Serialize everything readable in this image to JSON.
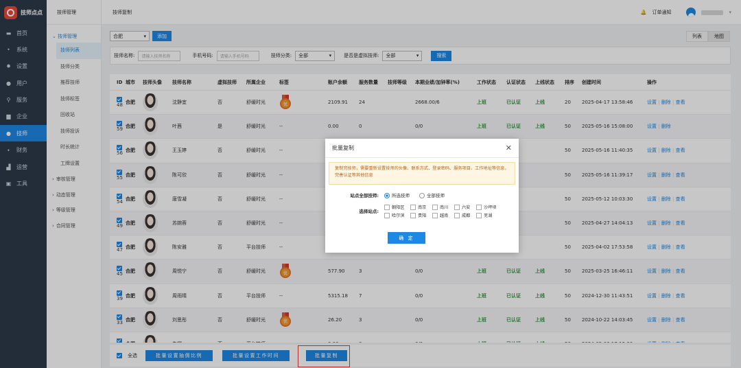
{
  "app": {
    "name": "技师点点"
  },
  "sidebar": {
    "items": [
      {
        "label": "首页",
        "icon": "monitor-icon",
        "glyph": "▬"
      },
      {
        "label": "系统",
        "icon": "sitemap-icon",
        "glyph": "⬩"
      },
      {
        "label": "设置",
        "icon": "gear-icon",
        "glyph": "✹"
      },
      {
        "label": "用户",
        "icon": "user-icon",
        "glyph": "●"
      },
      {
        "label": "服务",
        "icon": "link-icon",
        "glyph": "⚲"
      },
      {
        "label": "企业",
        "icon": "building-icon",
        "glyph": "▆"
      },
      {
        "label": "技师",
        "icon": "user-icon",
        "glyph": "●"
      },
      {
        "label": "财务",
        "icon": "sitemap-icon",
        "glyph": "⬩"
      },
      {
        "label": "运营",
        "icon": "chart-icon",
        "glyph": "▟"
      },
      {
        "label": "工具",
        "icon": "briefcase-icon",
        "glyph": "▣"
      }
    ],
    "active_index": 6
  },
  "subnav": {
    "title": "技师管理",
    "group": "技师管理",
    "items": [
      "技师列表",
      "技师分类",
      "推荐技师",
      "技师标签",
      "回收站",
      "技师投诉",
      "时长统计",
      "工牌设置"
    ],
    "active_index": 0,
    "groups": [
      "审核管理",
      "动态管理",
      "等级管理",
      "合同管理"
    ]
  },
  "topbar": {
    "breadcrumb": "技师复制",
    "notify": "订单通知"
  },
  "toolbar": {
    "city_select": "合肥",
    "add_label": "添加",
    "views": [
      "列表",
      "地图"
    ]
  },
  "filters": {
    "name_label": "技师名称:",
    "name_placeholder": "请输入技师名称",
    "phone_label": "手机号码:",
    "phone_placeholder": "请输入手机号码",
    "cat_label": "技师分类:",
    "cat_value": "全部",
    "virtual_label": "是否是虚拟技师:",
    "virtual_value": "全部",
    "search_label": "搜索"
  },
  "table": {
    "headers": [
      "ID",
      "城市",
      "技师头像",
      "技师名称",
      "虚拟技师",
      "所属企业",
      "标签",
      "账户余额",
      "服务数量",
      "技师等级",
      "本期业绩/加钟率(%)",
      "工作状态",
      "认证状态",
      "上线状态",
      "排序",
      "创建时间",
      "操作"
    ],
    "rows": [
      {
        "id": "48",
        "city": "合肥",
        "name": "沈静宜",
        "virtual": "否",
        "company": "舒缓时光",
        "tag": "medal",
        "balance": "2109.91",
        "count": "24",
        "perf": "2668.00/6",
        "work": "上班",
        "cert": "已认证",
        "online": "上线",
        "sort": "20",
        "created": "2025-04-17 13:58:46",
        "ops": [
          "设置",
          "删除",
          "查看"
        ]
      },
      {
        "id": "59",
        "city": "合肥",
        "name": "叶茜",
        "virtual": "是",
        "company": "舒缓时光",
        "tag": "--",
        "balance": "0.00",
        "count": "0",
        "perf": "0/0",
        "work": "上班",
        "cert": "已认证",
        "online": "上线",
        "sort": "50",
        "created": "2025-05-16 15:08:00",
        "ops": [
          "设置",
          "删除"
        ]
      },
      {
        "id": "56",
        "city": "合肥",
        "name": "王玉婷",
        "virtual": "否",
        "company": "舒缓时光",
        "tag": "--",
        "balance": "",
        "count": "",
        "perf": "",
        "work": "",
        "cert": "",
        "online": "",
        "sort": "50",
        "created": "2025-05-16 11:40:35",
        "ops": [
          "设置",
          "删除",
          "查看"
        ]
      },
      {
        "id": "55",
        "city": "合肥",
        "name": "陈可欣",
        "virtual": "否",
        "company": "舒缓时光",
        "tag": "--",
        "balance": "",
        "count": "",
        "perf": "",
        "work": "",
        "cert": "",
        "online": "",
        "sort": "50",
        "created": "2025-05-16 11:39:17",
        "ops": [
          "设置",
          "删除",
          "查看"
        ]
      },
      {
        "id": "54",
        "city": "合肥",
        "name": "唐雪凝",
        "virtual": "否",
        "company": "舒缓时光",
        "tag": "--",
        "balance": "",
        "count": "",
        "perf": "",
        "work": "",
        "cert": "",
        "online": "",
        "sort": "50",
        "created": "2025-05-12 10:03:30",
        "ops": [
          "设置",
          "删除",
          "查看"
        ]
      },
      {
        "id": "49",
        "city": "合肥",
        "name": "苏婉蓉",
        "virtual": "否",
        "company": "舒缓时光",
        "tag": "--",
        "balance": "",
        "count": "",
        "perf": "",
        "work": "",
        "cert": "",
        "online": "",
        "sort": "50",
        "created": "2025-04-27 14:04:13",
        "ops": [
          "设置",
          "删除",
          "查看"
        ]
      },
      {
        "id": "47",
        "city": "合肥",
        "name": "陈安雅",
        "virtual": "否",
        "company": "平台技师",
        "tag": "--",
        "balance": "",
        "count": "",
        "perf": "",
        "work": "",
        "cert": "",
        "online": "",
        "sort": "50",
        "created": "2025-04-02 17:53:58",
        "ops": [
          "设置",
          "删除",
          "查看"
        ]
      },
      {
        "id": "45",
        "city": "合肥",
        "name": "周悦宁",
        "virtual": "否",
        "company": "舒缓时光",
        "tag": "medal",
        "balance": "577.90",
        "count": "3",
        "perf": "0/0",
        "work": "上班",
        "cert": "已认证",
        "online": "上线",
        "sort": "50",
        "created": "2025-03-25 16:46:11",
        "ops": [
          "设置",
          "删除",
          "查看"
        ]
      },
      {
        "id": "39",
        "city": "合肥",
        "name": "周雨晴",
        "virtual": "否",
        "company": "平台技师",
        "tag": "--",
        "balance": "5315.18",
        "count": "7",
        "perf": "0/0",
        "work": "上班",
        "cert": "已认证",
        "online": "上线",
        "sort": "50",
        "created": "2024-12-30 11:43:51",
        "ops": [
          "设置",
          "删除",
          "查看"
        ]
      },
      {
        "id": "33",
        "city": "合肥",
        "name": "刘思彤",
        "virtual": "否",
        "company": "舒缓时光",
        "tag": "medal",
        "balance": "26.20",
        "count": "3",
        "perf": "0/0",
        "work": "上班",
        "cert": "已认证",
        "online": "上线",
        "sort": "50",
        "created": "2024-10-22 14:03:45",
        "ops": [
          "设置",
          "删除",
          "查看"
        ]
      },
      {
        "id": "25",
        "city": "合肥",
        "name": "朱娜",
        "virtual": "否",
        "company": "平台技师",
        "tag": "--",
        "balance": "0.00",
        "count": "0",
        "perf": "0/0",
        "work": "上班",
        "cert": "已认证",
        "online": "上线",
        "sort": "50",
        "created": "2024-05-06 17:12:30",
        "ops": [
          "设置",
          "删除",
          "查看"
        ]
      }
    ],
    "medal_text": "优"
  },
  "footer": {
    "select_all": "全选",
    "btn_ratio": "批量设置抽佣比例",
    "btn_worktime": "批量设置工作时间",
    "btn_copy": "批量复制"
  },
  "modal": {
    "title": "批量复制",
    "warning": "复制完技师，需要重新设置技师的头像、联系方式、登录密码、服务项目、工作地址等信息，完善认证等其他信息",
    "scope_label": "站点全部技师:",
    "scope_options": [
      "所选技师",
      "全部技师"
    ],
    "scope_selected": 0,
    "stations_label": "选择站点:",
    "stations": [
      "朝阳区",
      "南京",
      "南川",
      "六安",
      "沙坪坝",
      "哈尔滨",
      "贵阳",
      "越南",
      "成都",
      "芜湖"
    ],
    "confirm": "确 定"
  },
  "colors": {
    "accent": "#1e88e5",
    "sidebar": "#2d3a4b",
    "success": "#2e9d3e",
    "highlight": "#e53935"
  }
}
